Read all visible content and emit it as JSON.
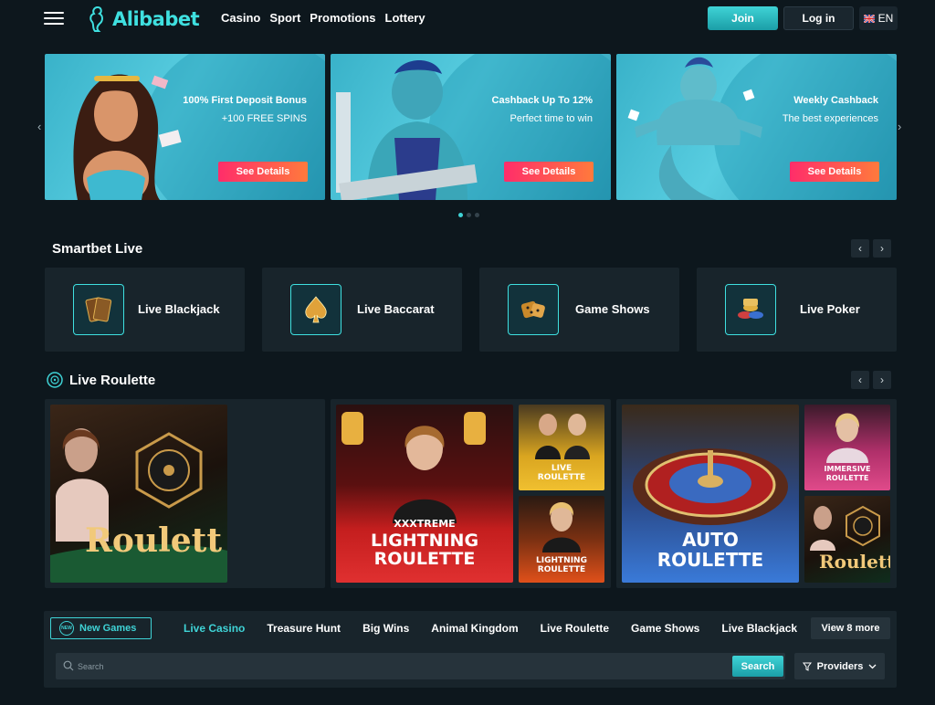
{
  "header": {
    "logo_text": "Alibabet",
    "nav": [
      "Casino",
      "Sport",
      "Promotions",
      "Lottery"
    ],
    "join_label": "Join",
    "login_label": "Log in",
    "lang_label": "EN"
  },
  "banners": [
    {
      "title": "100% First Deposit Bonus",
      "subtitle": "+100 FREE SPINS",
      "button": "See Details"
    },
    {
      "title": "Cashback Up To 12%",
      "subtitle": "Perfect time to win",
      "button": "See Details"
    },
    {
      "title": "Weekly Cashback",
      "subtitle": "The best experiences",
      "button": "See Details"
    }
  ],
  "carousel": {
    "slides": 3,
    "active_index": 0
  },
  "smartbet": {
    "title": "Smartbet Live",
    "cards": [
      {
        "label": "Live Blackjack",
        "icon": "cards-icon"
      },
      {
        "label": "Live Baccarat",
        "icon": "spade-icon"
      },
      {
        "label": "Game Shows",
        "icon": "dice-icon"
      },
      {
        "label": "Live Poker",
        "icon": "chips-icon"
      }
    ]
  },
  "roulette": {
    "title": "Live Roulette",
    "tiles": {
      "roulette_main": "Roulett",
      "lightning_top": "XXXTREME",
      "lightning_line1": "LIGHTNING",
      "lightning_line2": "ROULETTE",
      "live_roulette_1": "LIVE",
      "live_roulette_2": "ROULETTE",
      "lightning_small_1": "LIGHTNING",
      "lightning_small_2": "ROULETTE",
      "auto_1": "AUTO",
      "auto_2": "ROULETTE",
      "immersive_1": "IMMERSIVE",
      "immersive_2": "ROULETTE",
      "roulette_small": "Roulett"
    }
  },
  "filters": {
    "new_games_label": "New Games",
    "new_badge": "NEW",
    "tabs": [
      "Live Casino",
      "Treasure Hunt",
      "Big Wins",
      "Animal Kingdom",
      "Live Roulette",
      "Game Shows",
      "Live Blackjack"
    ],
    "active_tab": "Live Casino",
    "view_more_label": "View 8 more",
    "search_placeholder": "Search",
    "search_button": "Search",
    "providers_label": "Providers"
  },
  "colors": {
    "accent": "#3fd3d6",
    "background": "#0d171d",
    "card": "#18242b",
    "cta": "#ff2d6a"
  }
}
